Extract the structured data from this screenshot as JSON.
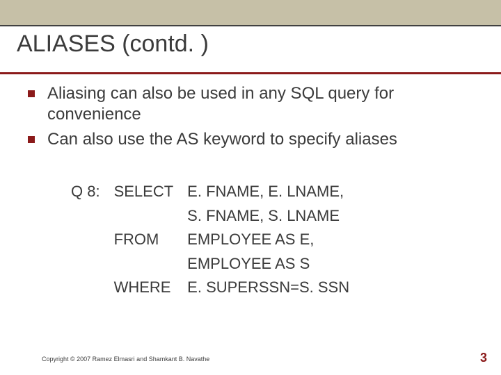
{
  "slide": {
    "title": "ALIASES (contd. )",
    "bullets": [
      "Aliasing can also be used in any SQL query for convenience",
      "Can also use the AS keyword to specify aliases"
    ],
    "query": {
      "label": "Q 8:",
      "rows": [
        {
          "kw": "SELECT",
          "val": "E. FNAME, E. LNAME,"
        },
        {
          "kw": "",
          "val": "S. FNAME, S. LNAME"
        },
        {
          "kw": "FROM",
          "val": "EMPLOYEE AS E,"
        },
        {
          "kw": "",
          "val": "EMPLOYEE AS S"
        },
        {
          "kw": "WHERE",
          "val": "E. SUPERSSN=S. SSN"
        }
      ]
    },
    "copyright": "Copyright © 2007 Ramez Elmasri and Shamkant B. Navathe",
    "page_number": "3"
  }
}
